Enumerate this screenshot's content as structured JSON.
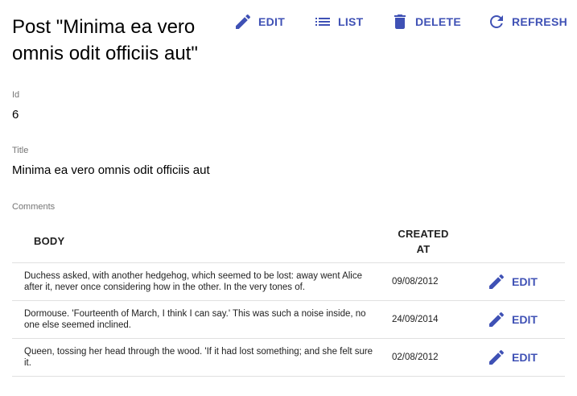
{
  "page": {
    "title": "Post \"Minima ea vero omnis odit officiis aut\""
  },
  "actions": {
    "edit": "EDIT",
    "list": "LIST",
    "delete": "DELETE",
    "refresh": "REFRESH"
  },
  "fields": {
    "id_label": "Id",
    "id_value": "6",
    "title_label": "Title",
    "title_value": "Minima ea vero omnis odit officiis aut",
    "comments_label": "Comments"
  },
  "comments": {
    "columns": {
      "body": "BODY",
      "created_at_line1": "CREATED",
      "created_at_line2": "AT"
    },
    "rows": [
      {
        "body": "Duchess asked, with another hedgehog, which seemed to be lost: away went Alice after it, never once considering how in the other. In the very tones of.",
        "created_at": "09/08/2012",
        "edit_label": "EDIT"
      },
      {
        "body": "Dormouse. 'Fourteenth of March, I think I can say.' This was such a noise inside, no one else seemed inclined.",
        "created_at": "24/09/2014",
        "edit_label": "EDIT"
      },
      {
        "body": "Queen, tossing her head through the wood. 'If it had lost something; and she felt sure it.",
        "created_at": "02/08/2012",
        "edit_label": "EDIT"
      }
    ]
  },
  "colors": {
    "accent": "#3f51b5",
    "label_gray": "#757575",
    "divider": "#e0e0e0"
  },
  "icons": {
    "edit": "pencil-icon",
    "list": "list-icon",
    "delete": "trash-icon",
    "refresh": "refresh-icon"
  }
}
